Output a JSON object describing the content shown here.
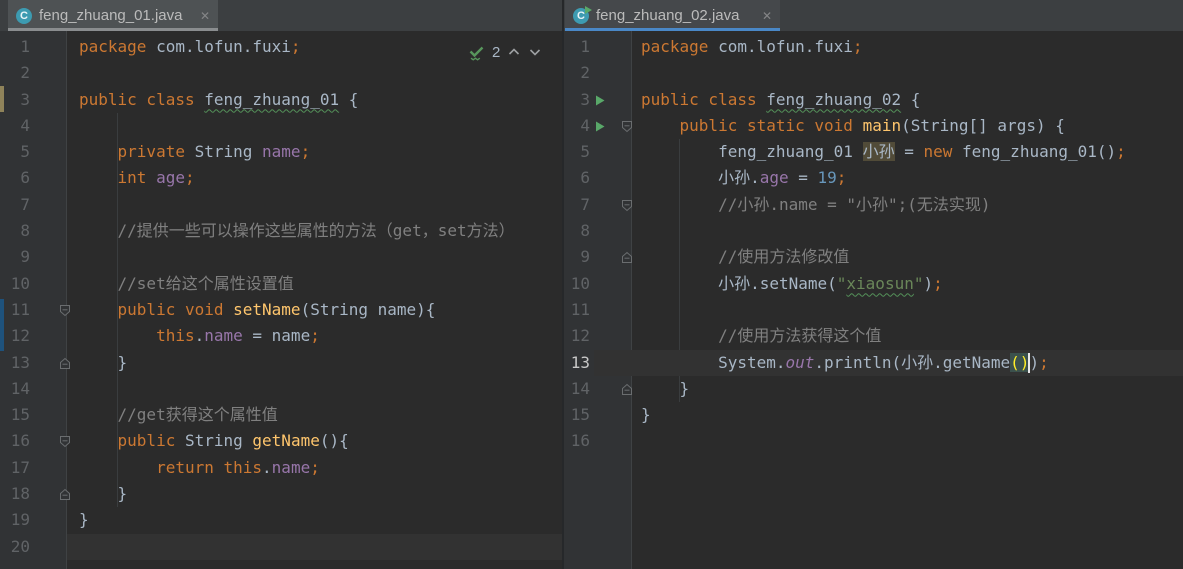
{
  "app": "IntelliJ IDEA editor (split view)",
  "colors": {
    "editor_bg": "#2b2b2b",
    "gutter_bg": "#313335",
    "tabbar_bg": "#3c3f41",
    "active_tab_underline": "#4a88c7",
    "inactive_tab_underline": "#8a8d8f",
    "run_green": "#59a869",
    "keyword_orange": "#cc7832",
    "string_green": "#6a8759",
    "number_blue": "#6897bb",
    "field_purple": "#9876aa",
    "method_yellow": "#ffc66d",
    "comment_gray": "#808080",
    "default_text": "#a9b7c6",
    "matched_paren_bg": "#3b514d",
    "identifier_highlight_bg": "#514b38"
  },
  "tabs": {
    "left": {
      "title": "feng_zhuang_01.java",
      "icon": "java-class-icon",
      "icon_letter": "C",
      "close_label": "✕",
      "state": "selected-inactive"
    },
    "right": {
      "title": "feng_zhuang_02.java",
      "icon": "runnable-java-class-icon",
      "icon_letter": "C",
      "close_label": "✕",
      "state": "selected-active"
    }
  },
  "inspection_widget": {
    "icon": "no-problems-check-icon",
    "count": "2",
    "prev": "chevron-up-icon",
    "next": "chevron-down-icon"
  },
  "panes": {
    "left": {
      "file": "feng_zhuang_01.java",
      "current_line": 20,
      "icons": {
        "11": [
          "fold-down"
        ],
        "13": [
          "fold-up"
        ],
        "16": [
          "fold-down"
        ],
        "18": [
          "fold-up"
        ]
      },
      "lines": [
        {
          "n": 1,
          "segs": [
            [
              "kw",
              "package "
            ],
            [
              "pl",
              "com.lofun.fuxi"
            ],
            [
              "kw",
              ";"
            ]
          ]
        },
        {
          "n": 2,
          "segs": []
        },
        {
          "n": 3,
          "segs": [
            [
              "kw",
              "public class "
            ],
            [
              "cl",
              "feng_zhuang_01"
            ],
            [
              "pl",
              " {"
            ]
          ]
        },
        {
          "n": 4,
          "segs": []
        },
        {
          "n": 5,
          "segs": [
            [
              "pl",
              "    "
            ],
            [
              "kw",
              "private "
            ],
            [
              "pl",
              "String "
            ],
            [
              "fd",
              "name"
            ],
            [
              "kw",
              ";"
            ]
          ]
        },
        {
          "n": 6,
          "segs": [
            [
              "pl",
              "    "
            ],
            [
              "kw",
              "int "
            ],
            [
              "fd",
              "age"
            ],
            [
              "kw",
              ";"
            ]
          ]
        },
        {
          "n": 7,
          "segs": []
        },
        {
          "n": 8,
          "segs": [
            [
              "pl",
              "    "
            ],
            [
              "cm",
              "//提供一些可以操作这些属性的方法（get，set方法）"
            ]
          ]
        },
        {
          "n": 9,
          "segs": []
        },
        {
          "n": 10,
          "segs": [
            [
              "pl",
              "    "
            ],
            [
              "cm",
              "//set给这个属性设置值"
            ]
          ]
        },
        {
          "n": 11,
          "segs": [
            [
              "pl",
              "    "
            ],
            [
              "kw",
              "public void "
            ],
            [
              "md",
              "setName"
            ],
            [
              "pl",
              "(String name){"
            ]
          ]
        },
        {
          "n": 12,
          "segs": [
            [
              "pl",
              "        "
            ],
            [
              "kw",
              "this"
            ],
            [
              "pl",
              "."
            ],
            [
              "fd",
              "name"
            ],
            [
              "pl",
              " = name"
            ],
            [
              "kw",
              ";"
            ]
          ]
        },
        {
          "n": 13,
          "segs": [
            [
              "pl",
              "    }"
            ]
          ]
        },
        {
          "n": 14,
          "segs": []
        },
        {
          "n": 15,
          "segs": [
            [
              "pl",
              "    "
            ],
            [
              "cm",
              "//get获得这个属性值"
            ]
          ]
        },
        {
          "n": 16,
          "segs": [
            [
              "pl",
              "    "
            ],
            [
              "kw",
              "public "
            ],
            [
              "pl",
              "String "
            ],
            [
              "md",
              "getName"
            ],
            [
              "pl",
              "(){"
            ]
          ]
        },
        {
          "n": 17,
          "segs": [
            [
              "pl",
              "        "
            ],
            [
              "kw",
              "return this"
            ],
            [
              "pl",
              "."
            ],
            [
              "fd",
              "name"
            ],
            [
              "kw",
              ";"
            ]
          ]
        },
        {
          "n": 18,
          "segs": [
            [
              "pl",
              "    }"
            ]
          ]
        },
        {
          "n": 19,
          "segs": [
            [
              "pl",
              "}"
            ]
          ]
        },
        {
          "n": 20,
          "segs": []
        }
      ]
    },
    "right": {
      "file": "feng_zhuang_02.java",
      "current_line": 13,
      "icons": {
        "3": [
          "run"
        ],
        "4": [
          "run",
          "fold-down"
        ],
        "7": [
          "fold-down"
        ],
        "9": [
          "fold-up"
        ],
        "14": [
          "fold-up"
        ]
      },
      "lines": [
        {
          "n": 1,
          "segs": [
            [
              "kw",
              "package "
            ],
            [
              "pl",
              "com.lofun.fuxi"
            ],
            [
              "kw",
              ";"
            ]
          ]
        },
        {
          "n": 2,
          "segs": []
        },
        {
          "n": 3,
          "segs": [
            [
              "kw",
              "public class "
            ],
            [
              "cl",
              "feng_zhuang_02"
            ],
            [
              "pl",
              " {"
            ]
          ]
        },
        {
          "n": 4,
          "segs": [
            [
              "pl",
              "    "
            ],
            [
              "kw",
              "public static void "
            ],
            [
              "md",
              "main"
            ],
            [
              "pl",
              "(String[] args) {"
            ]
          ]
        },
        {
          "n": 5,
          "segs": [
            [
              "pl",
              "        feng_zhuang_01 "
            ],
            [
              "hw",
              "小孙"
            ],
            [
              "pl",
              " = "
            ],
            [
              "kw",
              "new "
            ],
            [
              "pl",
              "feng_zhuang_01()"
            ],
            [
              "kw",
              ";"
            ]
          ]
        },
        {
          "n": 6,
          "segs": [
            [
              "pl",
              "        小孙."
            ],
            [
              "fd",
              "age"
            ],
            [
              "pl",
              " = "
            ],
            [
              "nm",
              "19"
            ],
            [
              "kw",
              ";"
            ]
          ]
        },
        {
          "n": 7,
          "segs": [
            [
              "pl",
              "        "
            ],
            [
              "cm",
              "//小孙.name = \"小孙\";(无法实现)"
            ]
          ]
        },
        {
          "n": 8,
          "segs": []
        },
        {
          "n": 9,
          "segs": [
            [
              "pl",
              "        "
            ],
            [
              "cm",
              "//使用方法修改值"
            ]
          ]
        },
        {
          "n": 10,
          "segs": [
            [
              "pl",
              "        小孙.setName("
            ],
            [
              "st",
              "\""
            ],
            [
              "sty",
              "xiaosun"
            ],
            [
              "st",
              "\""
            ],
            [
              "pl",
              ")"
            ],
            [
              "kw",
              ";"
            ]
          ]
        },
        {
          "n": 11,
          "segs": []
        },
        {
          "n": 12,
          "segs": [
            [
              "pl",
              "        "
            ],
            [
              "cm",
              "//使用方法获得这个值"
            ]
          ]
        },
        {
          "n": 13,
          "segs": [
            [
              "pl",
              "        System."
            ],
            [
              "sf",
              "out"
            ],
            [
              "pl",
              ".println(小孙.getName"
            ],
            [
              "pm",
              "()"
            ],
            [
              "caret",
              ""
            ],
            [
              "pl",
              ")"
            ],
            [
              "kw",
              ";"
            ]
          ]
        },
        {
          "n": 14,
          "segs": [
            [
              "pl",
              "    }"
            ]
          ]
        },
        {
          "n": 15,
          "segs": [
            [
              "pl",
              "}"
            ]
          ]
        },
        {
          "n": 16,
          "segs": []
        }
      ]
    }
  }
}
